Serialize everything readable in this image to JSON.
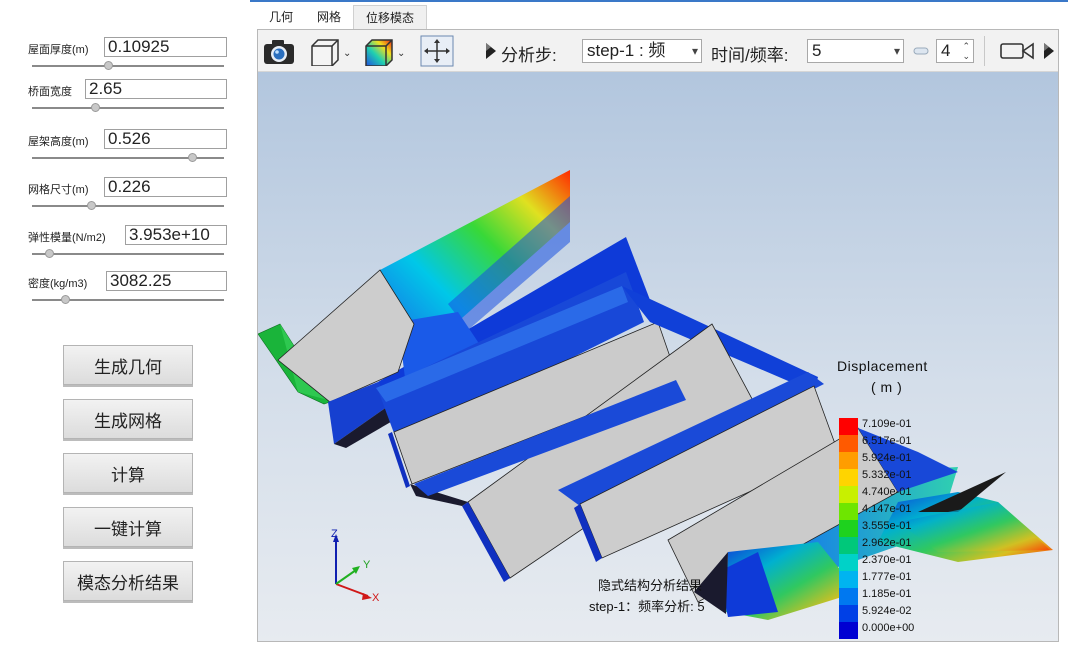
{
  "params": [
    {
      "label": "屋面厚度(m)",
      "value": "0.10925",
      "slider": 0.4
    },
    {
      "label": "桥面宽度",
      "value": "2.65",
      "slider": 0.33
    },
    {
      "label": "屋架高度(m)",
      "value": "0.526",
      "slider": 0.83
    },
    {
      "label": "网格尺寸(m)",
      "value": "0.226",
      "slider": 0.31
    },
    {
      "label": "弹性模量(N/m2)",
      "value": "3.953e+10",
      "slider": 0.09
    },
    {
      "label": "密度(kg/m3)",
      "value": "3082.25",
      "slider": 0.18
    }
  ],
  "buttons": [
    "生成几何",
    "生成网格",
    "计算",
    "一键计算",
    "模态分析结果"
  ],
  "tabs": [
    "几何",
    "网格",
    "位移模态"
  ],
  "active_tab": "位移模态",
  "toolbar": {
    "step_label": "分析步:",
    "step_value": "step-1 : 频",
    "time_label": "时间/频率:",
    "time_value": "5",
    "spin_value": "4"
  },
  "legend": {
    "title": "Displacement",
    "unit": "( m )",
    "labels": [
      "7.109e-01",
      "6.517e-01",
      "5.924e-01",
      "5.332e-01",
      "4.740e-01",
      "4.147e-01",
      "3.555e-01",
      "2.962e-01",
      "2.370e-01",
      "1.777e-01",
      "1.185e-01",
      "5.924e-02",
      "0.000e+00"
    ],
    "colors": [
      "#ff0000",
      "#ff5a00",
      "#ff9d00",
      "#ffd400",
      "#c8f000",
      "#6ee600",
      "#1ed21e",
      "#00c87a",
      "#00d2c8",
      "#00b4f0",
      "#0078f0",
      "#0040e6",
      "#0000d2"
    ]
  },
  "axes": {
    "z": "Z",
    "y": "Y",
    "x": "X"
  },
  "caption": {
    "line1": "隐式结构分析结果",
    "line2": "step-1：频率分析: 5"
  },
  "icons": [
    "camera-icon",
    "view-cube-icon",
    "color-cube-icon",
    "move-arrows-icon",
    "video-camera-icon"
  ]
}
